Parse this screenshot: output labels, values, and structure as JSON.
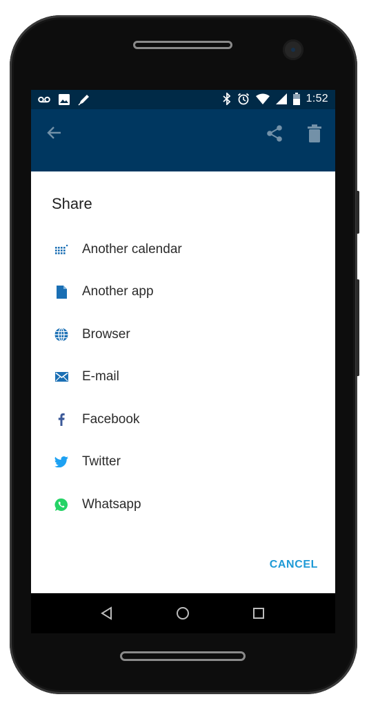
{
  "status_bar": {
    "time": "1:52",
    "left_icons": [
      "voicemail-icon",
      "image-icon",
      "edit-pen-icon"
    ],
    "right_icons": [
      "bluetooth-icon",
      "alarm-icon",
      "wifi-icon",
      "signal-icon",
      "battery-icon"
    ]
  },
  "app_bar": {
    "icons": [
      "back-arrow-icon",
      "share-icon",
      "delete-icon"
    ],
    "background": "#003760"
  },
  "dialog": {
    "title": "Share",
    "items": [
      {
        "label": "Another calendar",
        "icon": "calendar-dots-icon",
        "color": "#1a6fb4"
      },
      {
        "label": "Another app",
        "icon": "document-icon",
        "color": "#1a6fb4"
      },
      {
        "label": "Browser",
        "icon": "globe-icon",
        "color": "#1a6fb4"
      },
      {
        "label": "E-mail",
        "icon": "envelope-icon",
        "color": "#1a6fb4"
      },
      {
        "label": "Facebook",
        "icon": "facebook-icon",
        "color": "#3b5998"
      },
      {
        "label": "Twitter",
        "icon": "twitter-icon",
        "color": "#1da1f2"
      },
      {
        "label": "Whatsapp",
        "icon": "whatsapp-icon",
        "color": "#25d366"
      }
    ],
    "cancel_label": "CANCEL",
    "accent": "#1e9ad6"
  },
  "nav_bar": {
    "icons": [
      "back-triangle-icon",
      "home-circle-icon",
      "recents-square-icon"
    ]
  }
}
